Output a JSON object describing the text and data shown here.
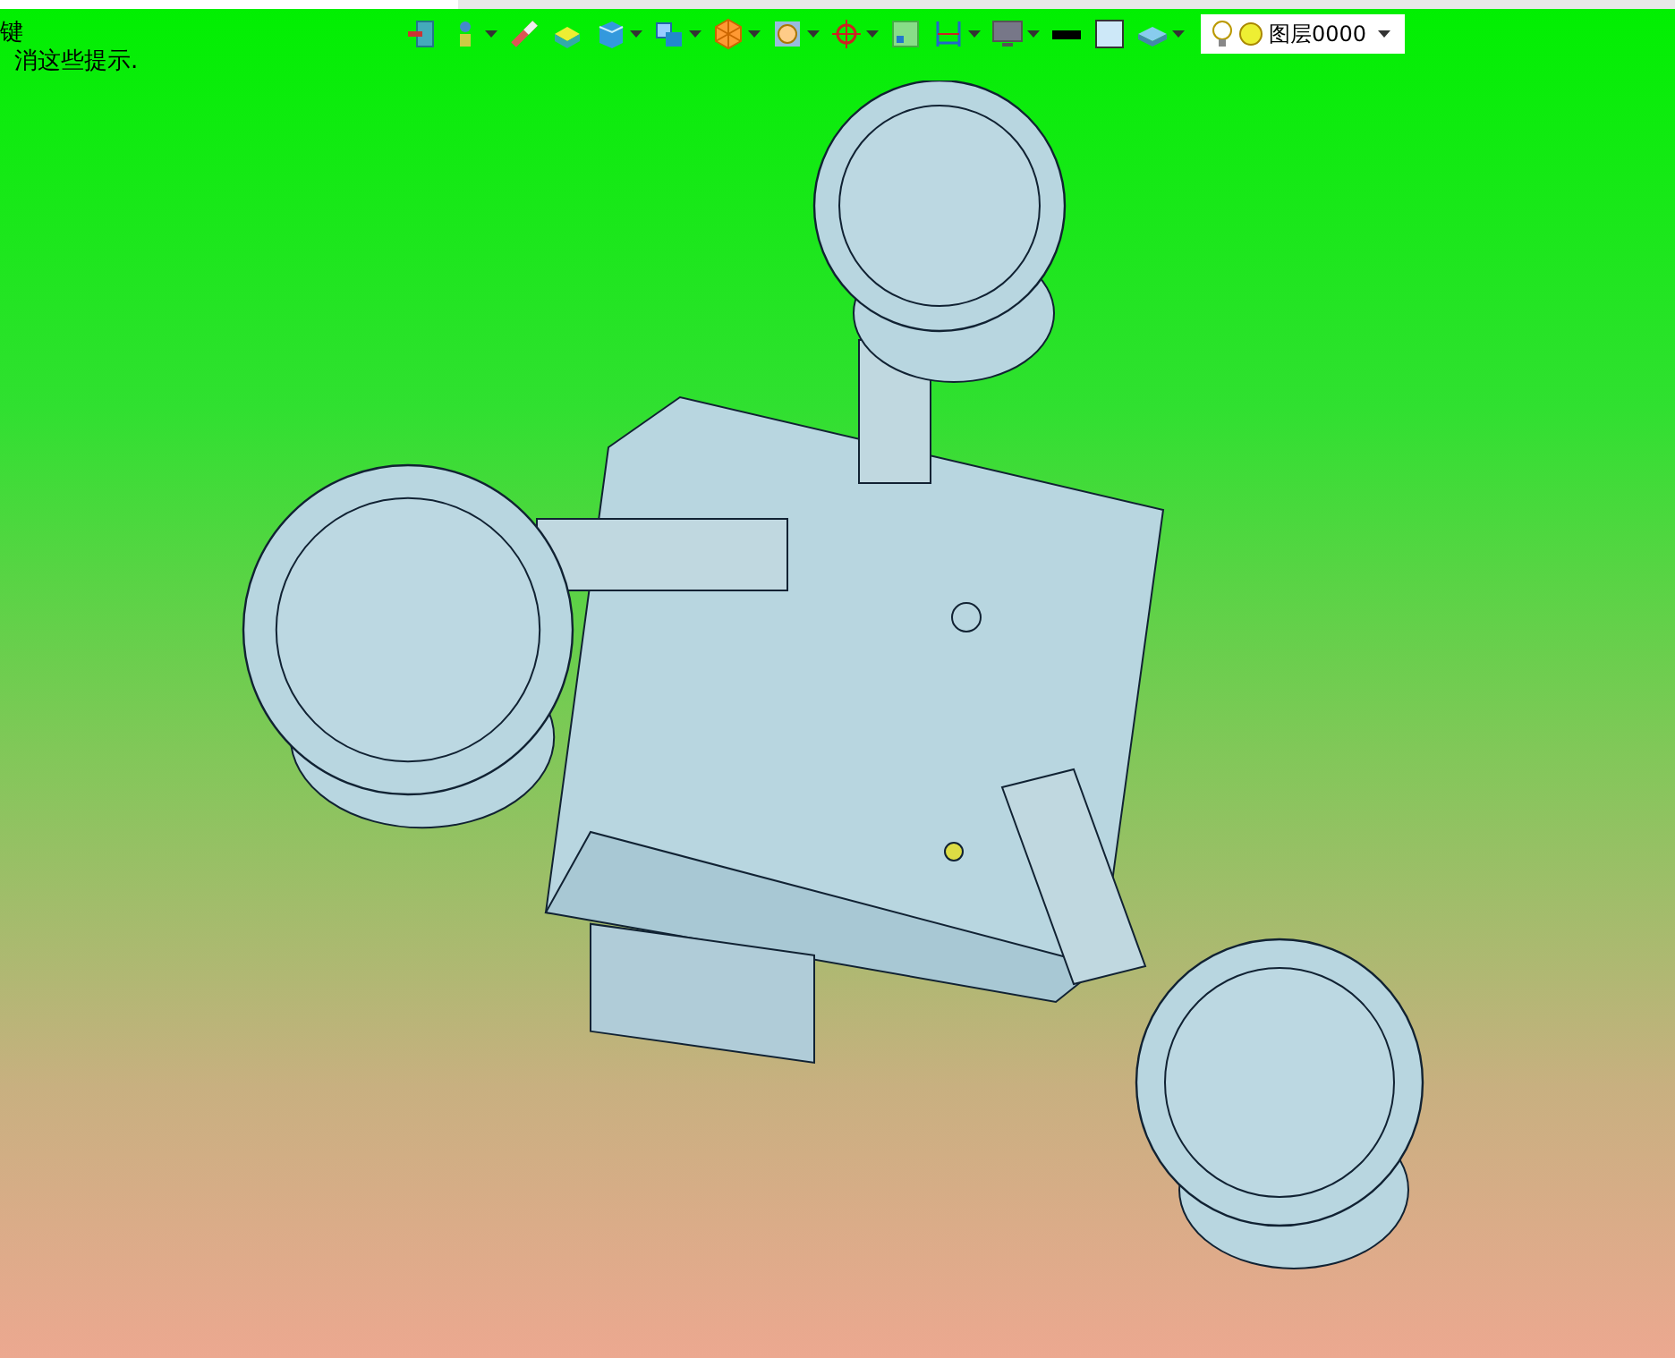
{
  "hints": [
    "键",
    "消这些提示."
  ],
  "toolbar": [
    {
      "dropdown": false
    },
    {
      "dropdown": true
    },
    {
      "dropdown": false
    },
    {
      "dropdown": false
    },
    {
      "dropdown": true
    },
    {
      "dropdown": true
    },
    {
      "dropdown": true
    },
    {
      "dropdown": true
    },
    {
      "dropdown": true
    },
    {
      "dropdown": false
    },
    {
      "dropdown": true
    },
    {
      "dropdown": true
    },
    {
      "dropdown": false
    },
    {
      "dropdown": false
    },
    {
      "dropdown": true
    }
  ],
  "layer_select": {
    "value": "图层0000"
  }
}
